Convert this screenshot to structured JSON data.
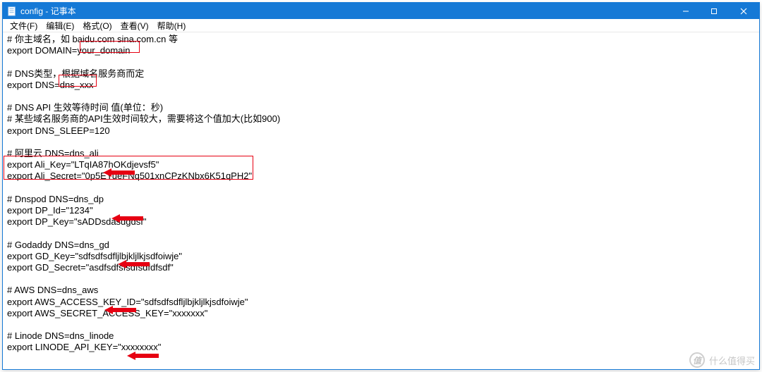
{
  "titlebar": {
    "title": "config - 记事本"
  },
  "menu": {
    "file": "文件(F)",
    "edit": "编辑(E)",
    "format": "格式(O)",
    "view": "查看(V)",
    "help": "帮助(H)"
  },
  "lines": [
    "# 你主域名，如 baidu.com sina.com.cn 等",
    "export DOMAIN=your_domain",
    "",
    "# DNS类型，根据域名服务商而定",
    "export DNS=dns_xxx",
    "",
    "# DNS API 生效等待时间 值(单位：秒)",
    "# 某些域名服务商的API生效时间较大，需要将这个值加大(比如900)",
    "export DNS_SLEEP=120",
    "",
    "# 阿里云 DNS=dns_ali",
    "export Ali_Key=\"LTqIA87hOKdjevsf5\"",
    "export Ali_Secret=\"0p5EYueFNq501xnCPzKNbx6K51qPH2\"",
    "",
    "# Dnspod DNS=dns_dp",
    "export DP_Id=\"1234\"",
    "export DP_Key=\"sADDsdasdgdsf\"",
    "",
    "# Godaddy DNS=dns_gd",
    "export GD_Key=\"sdfsdfsdfljlbjkljlkjsdfoiwje\"",
    "export GD_Secret=\"asdfsdfsfsdfsdfdfsdf\"",
    "",
    "# AWS DNS=dns_aws",
    "export AWS_ACCESS_KEY_ID=\"sdfsdfsdfljlbjkljlkjsdfoiwje\"",
    "export AWS_SECRET_ACCESS_KEY=\"xxxxxxx\"",
    "",
    "# Linode DNS=dns_linode",
    "export LINODE_API_KEY=\"xxxxxxxx\""
  ],
  "watermark": {
    "symbol": "值",
    "text": "什么值得买"
  }
}
